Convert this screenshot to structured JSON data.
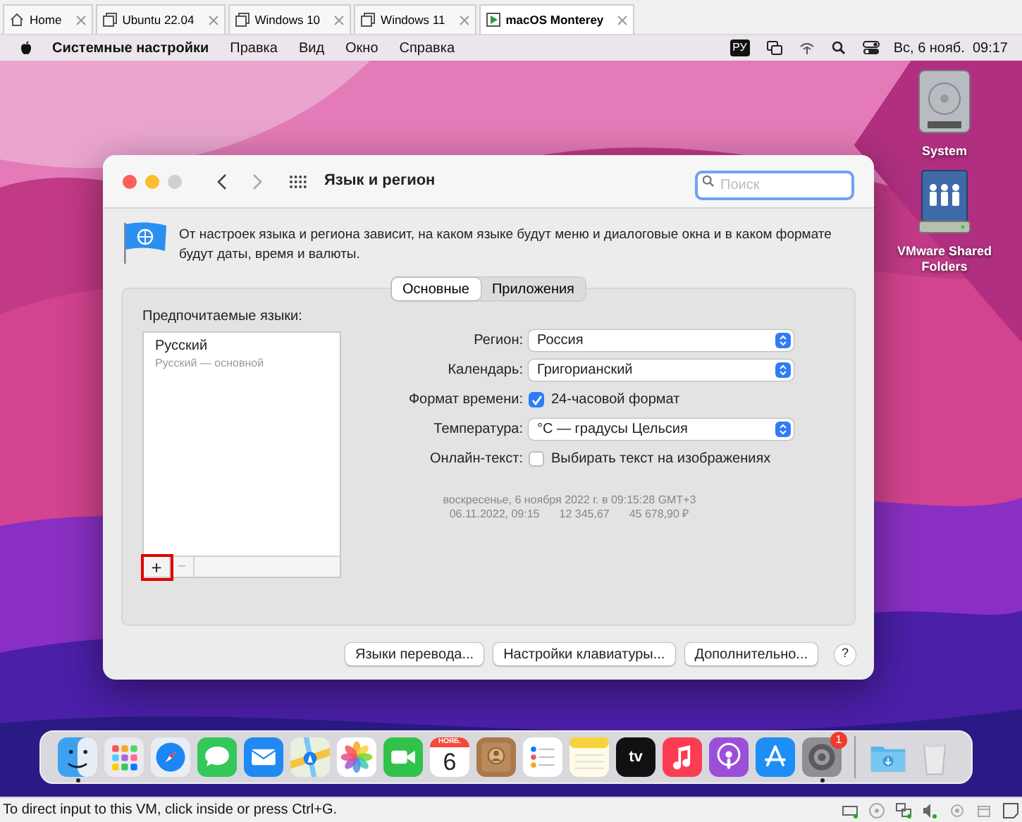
{
  "vm_tabs": [
    {
      "label": "Home",
      "kind": "home",
      "selected": false
    },
    {
      "label": "Ubuntu 22.04",
      "kind": "vm",
      "selected": false
    },
    {
      "label": "Windows 10",
      "kind": "vm",
      "selected": false
    },
    {
      "label": "Windows 11",
      "kind": "vm",
      "selected": false
    },
    {
      "label": "macOS Monterey",
      "kind": "running",
      "selected": true
    }
  ],
  "menu_bar": {
    "items": [
      "Системные настройки",
      "Правка",
      "Вид",
      "Окно",
      "Справка"
    ],
    "input_source": "РУ",
    "clock": "Вс, 6 нояб.  09:17"
  },
  "desktop_icons": [
    {
      "label": "System",
      "kind": "disk"
    },
    {
      "label": "VMware Shared Folders",
      "kind": "shared"
    }
  ],
  "window": {
    "title": "Язык и регион",
    "search": {
      "placeholder": "Поиск"
    },
    "description": "От настроек языка и региона зависит, на каком языке будут меню и диалоговые окна и в каком формате будут даты, время и валюты.",
    "tabs": [
      {
        "label": "Основные",
        "selected": true
      },
      {
        "label": "Приложения",
        "selected": false
      }
    ],
    "languages": {
      "heading": "Предпочитаемые языки:",
      "items": [
        {
          "name": "Русский",
          "detail": "Русский — основной"
        }
      ],
      "add": {
        "label": "+",
        "highlighted": true
      },
      "remove": {
        "label": "−",
        "disabled": true
      }
    },
    "settings": [
      {
        "kind": "select",
        "label": "Регион:",
        "value": "Россия"
      },
      {
        "kind": "select",
        "label": "Календарь:",
        "value": "Григорианский"
      },
      {
        "kind": "checkbox",
        "label": "Формат времени:",
        "text": "24-часовой формат",
        "checked": true
      },
      {
        "kind": "select",
        "label": "Температура:",
        "value": "°C — градусы Цельсия"
      },
      {
        "kind": "checkbox",
        "label": "Онлайн-текст:",
        "text": "Выбирать текст на изображениях",
        "checked": false
      }
    ],
    "sample_date": "воскресенье, 6 ноября 2022 г. в 09:15:28 GMT+3",
    "sample_values": [
      "06.11.2022, 09:15",
      "12 345,67",
      "45 678,90 ₽"
    ],
    "buttons": [
      "Языки перевода...",
      "Настройки клавиатуры...",
      "Дополнительно..."
    ],
    "help": "?"
  },
  "dock": {
    "items": [
      {
        "kind": "finder",
        "running": true
      },
      {
        "kind": "launchpad",
        "running": false
      },
      {
        "kind": "safari",
        "running": false
      },
      {
        "kind": "messages",
        "running": false
      },
      {
        "kind": "mail",
        "running": false
      },
      {
        "kind": "maps",
        "running": false
      },
      {
        "kind": "photos",
        "running": false
      },
      {
        "kind": "facetime",
        "running": false
      },
      {
        "kind": "calendar",
        "running": false,
        "month": "НОЯБ.",
        "day": "6"
      },
      {
        "kind": "contacts",
        "running": false
      },
      {
        "kind": "reminders",
        "running": false
      },
      {
        "kind": "notes",
        "running": false
      },
      {
        "kind": "tv",
        "running": false,
        "label": "tv"
      },
      {
        "kind": "music",
        "running": false
      },
      {
        "kind": "podcasts",
        "running": false
      },
      {
        "kind": "appstore",
        "running": false
      },
      {
        "kind": "settings",
        "running": true,
        "badge": "1"
      },
      {
        "kind": "separator"
      },
      {
        "kind": "downloads",
        "running": false
      },
      {
        "kind": "trash",
        "running": false
      }
    ]
  },
  "status_bar": {
    "text": "To direct input to this VM, click inside or press Ctrl+G."
  }
}
